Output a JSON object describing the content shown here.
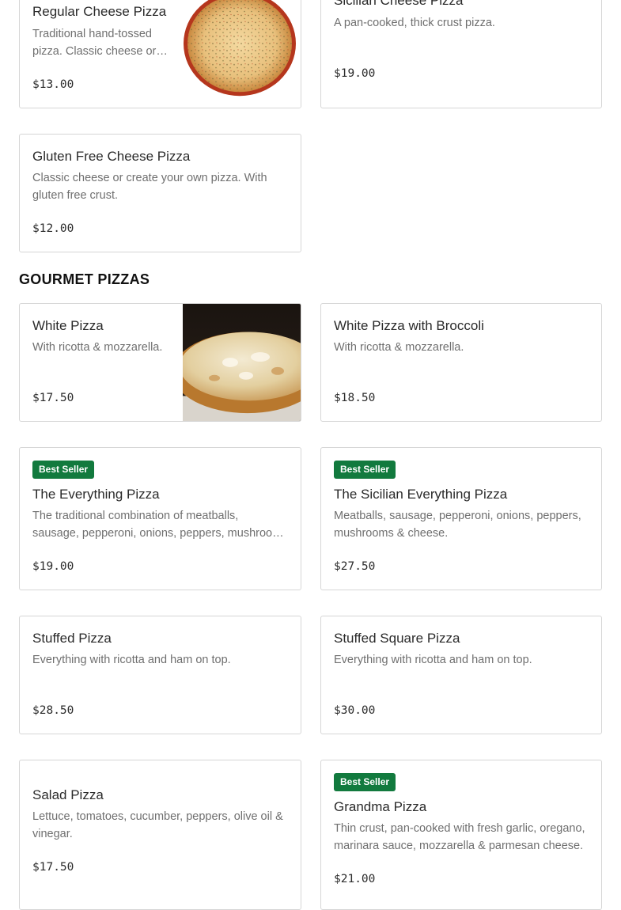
{
  "section": {
    "title": "GOURMET PIZZAS"
  },
  "items": {
    "regular_cheese": {
      "name": "Regular Cheese Pizza",
      "desc": "Traditional hand-tossed pizza. Classic cheese or create your own pizza.",
      "price": "$13.00",
      "image": "cheese-pizza-image"
    },
    "sicilian_cheese": {
      "name": "Sicilian Cheese Pizza",
      "desc": "A pan-cooked, thick crust pizza.",
      "price": "$19.00"
    },
    "gluten_free": {
      "name": "Gluten Free Cheese Pizza",
      "desc": "Classic cheese or create your own pizza. With gluten free crust.",
      "price": "$12.00"
    },
    "white": {
      "name": "White Pizza",
      "desc": "With ricotta & mozzarella.",
      "price": "$17.50",
      "image": "white-pizza-image"
    },
    "white_broccoli": {
      "name": "White Pizza with Broccoli",
      "desc": "With ricotta & mozzarella.",
      "price": "$18.50"
    },
    "everything": {
      "badge": "Best Seller",
      "name": "The Everything Pizza",
      "desc": "The traditional combination of meatballs, sausage, pepperoni, onions, peppers, mushrooms & cheese.",
      "price": "$19.00"
    },
    "sicilian_everything": {
      "badge": "Best Seller",
      "name": "The Sicilian Everything Pizza",
      "desc": "Meatballs, sausage, pepperoni, onions, peppers, mushrooms & cheese.",
      "price": "$27.50"
    },
    "stuffed": {
      "name": "Stuffed Pizza",
      "desc": "Everything with ricotta and ham on top.",
      "price": "$28.50"
    },
    "stuffed_square": {
      "name": "Stuffed Square Pizza",
      "desc": "Everything with ricotta and ham on top.",
      "price": "$30.00"
    },
    "salad": {
      "name": "Salad Pizza",
      "desc": "Lettuce, tomatoes, cucumber, peppers, olive oil & vinegar.",
      "price": "$17.50"
    },
    "grandma": {
      "badge": "Best Seller",
      "name": "Grandma Pizza",
      "desc": "Thin crust, pan-cooked with fresh garlic, oregano, marinara sauce, mozzarella & parmesan cheese.",
      "price": "$21.00"
    }
  },
  "colors": {
    "badge": "#127a3e",
    "border": "#d6d6d6",
    "text": "#2b2b2b",
    "muted": "#6f6f6f"
  }
}
